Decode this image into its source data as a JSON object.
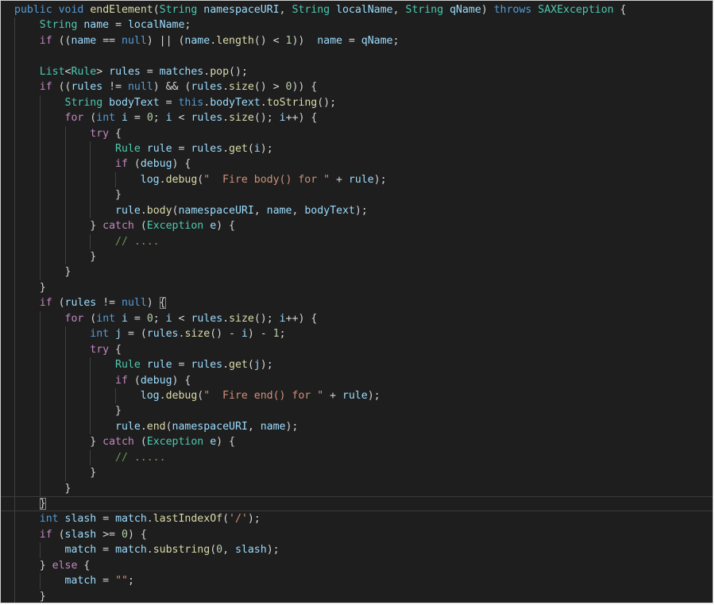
{
  "editor": {
    "lines": [
      {
        "indent": 0,
        "tokens": [
          [
            "kw",
            "public"
          ],
          [
            "p",
            " "
          ],
          [
            "kw",
            "void"
          ],
          [
            "p",
            " "
          ],
          [
            "fn",
            "endElement"
          ],
          [
            "p",
            "("
          ],
          [
            "type",
            "String"
          ],
          [
            "p",
            " "
          ],
          [
            "var",
            "namespaceURI"
          ],
          [
            "p",
            ", "
          ],
          [
            "type",
            "String"
          ],
          [
            "p",
            " "
          ],
          [
            "var",
            "localName"
          ],
          [
            "p",
            ", "
          ],
          [
            "type",
            "String"
          ],
          [
            "p",
            " "
          ],
          [
            "var",
            "qName"
          ],
          [
            "p",
            ") "
          ],
          [
            "kw",
            "throws"
          ],
          [
            "p",
            " "
          ],
          [
            "type",
            "SAXException"
          ],
          [
            "p",
            " {"
          ]
        ]
      },
      {
        "indent": 1,
        "tokens": [
          [
            "type",
            "String"
          ],
          [
            "p",
            " "
          ],
          [
            "var",
            "name"
          ],
          [
            "p",
            " = "
          ],
          [
            "var",
            "localName"
          ],
          [
            "p",
            ";"
          ]
        ]
      },
      {
        "indent": 1,
        "tokens": [
          [
            "ctl",
            "if"
          ],
          [
            "p",
            " (("
          ],
          [
            "var",
            "name"
          ],
          [
            "p",
            " == "
          ],
          [
            "kw",
            "null"
          ],
          [
            "p",
            ") || ("
          ],
          [
            "var",
            "name"
          ],
          [
            "p",
            "."
          ],
          [
            "fn",
            "length"
          ],
          [
            "p",
            "() < "
          ],
          [
            "num",
            "1"
          ],
          [
            "p",
            "))  "
          ],
          [
            "var",
            "name"
          ],
          [
            "p",
            " = "
          ],
          [
            "var",
            "qName"
          ],
          [
            "p",
            ";"
          ]
        ]
      },
      {
        "indent": 1,
        "tokens": []
      },
      {
        "indent": 1,
        "tokens": [
          [
            "type",
            "List"
          ],
          [
            "p",
            "<"
          ],
          [
            "type",
            "Rule"
          ],
          [
            "p",
            "> "
          ],
          [
            "var",
            "rules"
          ],
          [
            "p",
            " = "
          ],
          [
            "var",
            "matches"
          ],
          [
            "p",
            "."
          ],
          [
            "fn",
            "pop"
          ],
          [
            "p",
            "();"
          ]
        ]
      },
      {
        "indent": 1,
        "tokens": [
          [
            "ctl",
            "if"
          ],
          [
            "p",
            " (("
          ],
          [
            "var",
            "rules"
          ],
          [
            "p",
            " != "
          ],
          [
            "kw",
            "null"
          ],
          [
            "p",
            ") && ("
          ],
          [
            "var",
            "rules"
          ],
          [
            "p",
            "."
          ],
          [
            "fn",
            "size"
          ],
          [
            "p",
            "() > "
          ],
          [
            "num",
            "0"
          ],
          [
            "p",
            ")) {"
          ]
        ]
      },
      {
        "indent": 2,
        "tokens": [
          [
            "type",
            "String"
          ],
          [
            "p",
            " "
          ],
          [
            "var",
            "bodyText"
          ],
          [
            "p",
            " = "
          ],
          [
            "kw",
            "this"
          ],
          [
            "p",
            "."
          ],
          [
            "var",
            "bodyText"
          ],
          [
            "p",
            "."
          ],
          [
            "fn",
            "toString"
          ],
          [
            "p",
            "();"
          ]
        ]
      },
      {
        "indent": 2,
        "tokens": [
          [
            "ctl",
            "for"
          ],
          [
            "p",
            " ("
          ],
          [
            "kw",
            "int"
          ],
          [
            "p",
            " "
          ],
          [
            "var",
            "i"
          ],
          [
            "p",
            " = "
          ],
          [
            "num",
            "0"
          ],
          [
            "p",
            "; "
          ],
          [
            "var",
            "i"
          ],
          [
            "p",
            " < "
          ],
          [
            "var",
            "rules"
          ],
          [
            "p",
            "."
          ],
          [
            "fn",
            "size"
          ],
          [
            "p",
            "(); "
          ],
          [
            "var",
            "i"
          ],
          [
            "p",
            "++) {"
          ]
        ]
      },
      {
        "indent": 3,
        "tokens": [
          [
            "ctl",
            "try"
          ],
          [
            "p",
            " {"
          ]
        ]
      },
      {
        "indent": 4,
        "tokens": [
          [
            "type",
            "Rule"
          ],
          [
            "p",
            " "
          ],
          [
            "var",
            "rule"
          ],
          [
            "p",
            " = "
          ],
          [
            "var",
            "rules"
          ],
          [
            "p",
            "."
          ],
          [
            "fn",
            "get"
          ],
          [
            "p",
            "("
          ],
          [
            "var",
            "i"
          ],
          [
            "p",
            ");"
          ]
        ]
      },
      {
        "indent": 4,
        "tokens": [
          [
            "ctl",
            "if"
          ],
          [
            "p",
            " ("
          ],
          [
            "var",
            "debug"
          ],
          [
            "p",
            ") {"
          ]
        ]
      },
      {
        "indent": 5,
        "tokens": [
          [
            "var",
            "log"
          ],
          [
            "p",
            "."
          ],
          [
            "fn",
            "debug"
          ],
          [
            "p",
            "("
          ],
          [
            "str",
            "\"  Fire body() for \""
          ],
          [
            "p",
            " + "
          ],
          [
            "var",
            "rule"
          ],
          [
            "p",
            ");"
          ]
        ]
      },
      {
        "indent": 4,
        "tokens": [
          [
            "p",
            "}"
          ]
        ]
      },
      {
        "indent": 4,
        "tokens": [
          [
            "var",
            "rule"
          ],
          [
            "p",
            "."
          ],
          [
            "fn",
            "body"
          ],
          [
            "p",
            "("
          ],
          [
            "var",
            "namespaceURI"
          ],
          [
            "p",
            ", "
          ],
          [
            "var",
            "name"
          ],
          [
            "p",
            ", "
          ],
          [
            "var",
            "bodyText"
          ],
          [
            "p",
            ");"
          ]
        ]
      },
      {
        "indent": 3,
        "tokens": [
          [
            "p",
            "} "
          ],
          [
            "ctl",
            "catch"
          ],
          [
            "p",
            " ("
          ],
          [
            "type",
            "Exception"
          ],
          [
            "p",
            " "
          ],
          [
            "var",
            "e"
          ],
          [
            "p",
            ") {"
          ]
        ]
      },
      {
        "indent": 4,
        "tokens": [
          [
            "cmt",
            "// ...."
          ]
        ]
      },
      {
        "indent": 3,
        "tokens": [
          [
            "p",
            "}"
          ]
        ]
      },
      {
        "indent": 2,
        "tokens": [
          [
            "p",
            "}"
          ]
        ]
      },
      {
        "indent": 1,
        "tokens": [
          [
            "p",
            "}"
          ]
        ]
      },
      {
        "indent": 1,
        "tokens": [
          [
            "ctl",
            "if"
          ],
          [
            "p",
            " ("
          ],
          [
            "var",
            "rules"
          ],
          [
            "p",
            " != "
          ],
          [
            "kw",
            "null"
          ],
          [
            "p",
            ") "
          ],
          [
            "brk",
            "{"
          ]
        ]
      },
      {
        "indent": 2,
        "tokens": [
          [
            "ctl",
            "for"
          ],
          [
            "p",
            " ("
          ],
          [
            "kw",
            "int"
          ],
          [
            "p",
            " "
          ],
          [
            "var",
            "i"
          ],
          [
            "p",
            " = "
          ],
          [
            "num",
            "0"
          ],
          [
            "p",
            "; "
          ],
          [
            "var",
            "i"
          ],
          [
            "p",
            " < "
          ],
          [
            "var",
            "rules"
          ],
          [
            "p",
            "."
          ],
          [
            "fn",
            "size"
          ],
          [
            "p",
            "(); "
          ],
          [
            "var",
            "i"
          ],
          [
            "p",
            "++) {"
          ]
        ]
      },
      {
        "indent": 3,
        "tokens": [
          [
            "kw",
            "int"
          ],
          [
            "p",
            " "
          ],
          [
            "var",
            "j"
          ],
          [
            "p",
            " = ("
          ],
          [
            "var",
            "rules"
          ],
          [
            "p",
            "."
          ],
          [
            "fn",
            "size"
          ],
          [
            "p",
            "() - "
          ],
          [
            "var",
            "i"
          ],
          [
            "p",
            ") - "
          ],
          [
            "num",
            "1"
          ],
          [
            "p",
            ";"
          ]
        ]
      },
      {
        "indent": 3,
        "tokens": [
          [
            "ctl",
            "try"
          ],
          [
            "p",
            " {"
          ]
        ]
      },
      {
        "indent": 4,
        "tokens": [
          [
            "type",
            "Rule"
          ],
          [
            "p",
            " "
          ],
          [
            "var",
            "rule"
          ],
          [
            "p",
            " = "
          ],
          [
            "var",
            "rules"
          ],
          [
            "p",
            "."
          ],
          [
            "fn",
            "get"
          ],
          [
            "p",
            "("
          ],
          [
            "var",
            "j"
          ],
          [
            "p",
            ");"
          ]
        ]
      },
      {
        "indent": 4,
        "tokens": [
          [
            "ctl",
            "if"
          ],
          [
            "p",
            " ("
          ],
          [
            "var",
            "debug"
          ],
          [
            "p",
            ") {"
          ]
        ]
      },
      {
        "indent": 5,
        "tokens": [
          [
            "var",
            "log"
          ],
          [
            "p",
            "."
          ],
          [
            "fn",
            "debug"
          ],
          [
            "p",
            "("
          ],
          [
            "str",
            "\"  Fire end() for \""
          ],
          [
            "p",
            " + "
          ],
          [
            "var",
            "rule"
          ],
          [
            "p",
            ");"
          ]
        ]
      },
      {
        "indent": 4,
        "tokens": [
          [
            "p",
            "}"
          ]
        ]
      },
      {
        "indent": 4,
        "tokens": [
          [
            "var",
            "rule"
          ],
          [
            "p",
            "."
          ],
          [
            "fn",
            "end"
          ],
          [
            "p",
            "("
          ],
          [
            "var",
            "namespaceURI"
          ],
          [
            "p",
            ", "
          ],
          [
            "var",
            "name"
          ],
          [
            "p",
            ");"
          ]
        ]
      },
      {
        "indent": 3,
        "tokens": [
          [
            "p",
            "} "
          ],
          [
            "ctl",
            "catch"
          ],
          [
            "p",
            " ("
          ],
          [
            "type",
            "Exception"
          ],
          [
            "p",
            " "
          ],
          [
            "var",
            "e"
          ],
          [
            "p",
            ") {"
          ]
        ]
      },
      {
        "indent": 4,
        "tokens": [
          [
            "cmt",
            "// ....."
          ]
        ]
      },
      {
        "indent": 3,
        "tokens": [
          [
            "p",
            "}"
          ]
        ]
      },
      {
        "indent": 2,
        "tokens": [
          [
            "p",
            "}"
          ]
        ]
      },
      {
        "indent": 1,
        "tokens": [
          [
            "brk",
            "}"
          ]
        ],
        "current": true
      },
      {
        "indent": 1,
        "tokens": [
          [
            "kw",
            "int"
          ],
          [
            "p",
            " "
          ],
          [
            "var",
            "slash"
          ],
          [
            "p",
            " = "
          ],
          [
            "var",
            "match"
          ],
          [
            "p",
            "."
          ],
          [
            "fn",
            "lastIndexOf"
          ],
          [
            "p",
            "("
          ],
          [
            "str",
            "'/'"
          ],
          [
            "p",
            ");"
          ]
        ]
      },
      {
        "indent": 1,
        "tokens": [
          [
            "ctl",
            "if"
          ],
          [
            "p",
            " ("
          ],
          [
            "var",
            "slash"
          ],
          [
            "p",
            " >= "
          ],
          [
            "num",
            "0"
          ],
          [
            "p",
            ") {"
          ]
        ]
      },
      {
        "indent": 2,
        "tokens": [
          [
            "var",
            "match"
          ],
          [
            "p",
            " = "
          ],
          [
            "var",
            "match"
          ],
          [
            "p",
            "."
          ],
          [
            "fn",
            "substring"
          ],
          [
            "p",
            "("
          ],
          [
            "num",
            "0"
          ],
          [
            "p",
            ", "
          ],
          [
            "var",
            "slash"
          ],
          [
            "p",
            ");"
          ]
        ]
      },
      {
        "indent": 1,
        "tokens": [
          [
            "p",
            "} "
          ],
          [
            "ctl",
            "else"
          ],
          [
            "p",
            " {"
          ]
        ]
      },
      {
        "indent": 2,
        "tokens": [
          [
            "var",
            "match"
          ],
          [
            "p",
            " = "
          ],
          [
            "str",
            "\"\""
          ],
          [
            "p",
            ";"
          ]
        ]
      },
      {
        "indent": 1,
        "tokens": [
          [
            "p",
            "}"
          ]
        ]
      }
    ]
  },
  "colors": {
    "background": "#1e1e1e",
    "keyword": "#569cd6",
    "control": "#c586c0",
    "type": "#4ec9b0",
    "variable": "#9cdcfe",
    "function": "#dcdcaa",
    "number": "#b5cea8",
    "string": "#ce9178",
    "comment": "#6a9955",
    "punctuation": "#d4d4d4"
  }
}
